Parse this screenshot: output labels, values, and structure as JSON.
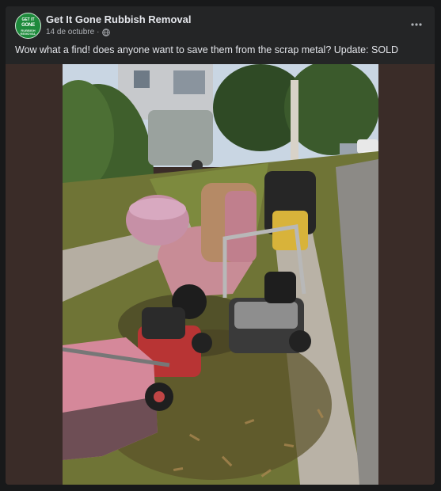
{
  "post": {
    "author": "Get It Gone Rubbish Removal",
    "date": "14 de octubre",
    "separator": "·",
    "privacy_icon": "globe-icon",
    "more_icon": "more-options-icon",
    "caption": "Wow what a find! does anyone want to save them from the scrap metal? Update: SOLD"
  },
  "avatar": {
    "logo_line_1": "GET IT",
    "logo_line_2": "GONE",
    "logo_line_3": "RUBBISH REMOVAL"
  },
  "photo": {
    "subject": "scrap-items-on-footpath"
  },
  "colors": {
    "background": "#18191a",
    "card": "#242526",
    "media_frame": "#3a2c28",
    "primary_text": "#e4e6eb",
    "secondary_text": "#b0b3b8",
    "brand_green": "#1e8a3c"
  }
}
